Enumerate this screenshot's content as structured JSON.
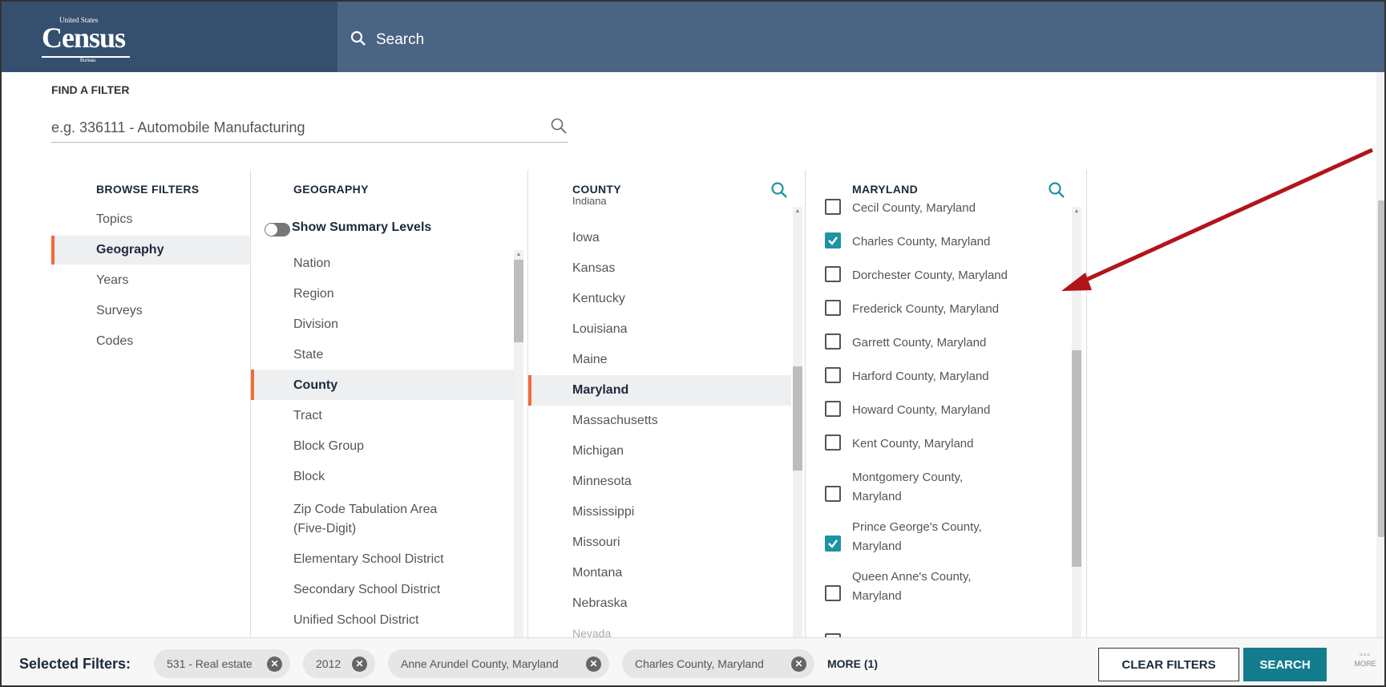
{
  "header": {
    "logo_small": "United States",
    "logo_big": "Census",
    "logo_bureau": "Bureau",
    "search_label": "Search"
  },
  "find_filter": {
    "label": "FIND A FILTER",
    "placeholder": "e.g. 336111 - Automobile Manufacturing",
    "value": ""
  },
  "browse": {
    "title": "BROWSE FILTERS",
    "items": [
      {
        "label": "Topics",
        "selected": false
      },
      {
        "label": "Geography",
        "selected": true
      },
      {
        "label": "Years",
        "selected": false
      },
      {
        "label": "Surveys",
        "selected": false
      },
      {
        "label": "Codes",
        "selected": false
      }
    ]
  },
  "geography": {
    "title": "GEOGRAPHY",
    "toggle_label": "Show Summary Levels",
    "toggle_on": false,
    "items": [
      {
        "label": "Nation",
        "selected": false
      },
      {
        "label": "Region",
        "selected": false
      },
      {
        "label": "Division",
        "selected": false
      },
      {
        "label": "State",
        "selected": false
      },
      {
        "label": "County",
        "selected": true
      },
      {
        "label": "Tract",
        "selected": false
      },
      {
        "label": "Block Group",
        "selected": false
      },
      {
        "label": "Block",
        "selected": false
      },
      {
        "label": "Zip Code Tabulation Area",
        "label2": "(Five-Digit)",
        "selected": false
      },
      {
        "label": "Elementary School District",
        "selected": false
      },
      {
        "label": "Secondary School District",
        "selected": false
      },
      {
        "label": "Unified School District",
        "selected": false
      }
    ]
  },
  "county": {
    "title": "COUNTY",
    "partial_top": "Indiana",
    "partial_bottom": "Nevada",
    "items": [
      {
        "label": "Iowa",
        "selected": false
      },
      {
        "label": "Kansas",
        "selected": false
      },
      {
        "label": "Kentucky",
        "selected": false
      },
      {
        "label": "Louisiana",
        "selected": false
      },
      {
        "label": "Maine",
        "selected": false
      },
      {
        "label": "Maryland",
        "selected": true
      },
      {
        "label": "Massachusetts",
        "selected": false
      },
      {
        "label": "Michigan",
        "selected": false
      },
      {
        "label": "Minnesota",
        "selected": false
      },
      {
        "label": "Mississippi",
        "selected": false
      },
      {
        "label": "Missouri",
        "selected": false
      },
      {
        "label": "Montana",
        "selected": false
      },
      {
        "label": "Nebraska",
        "selected": false
      }
    ]
  },
  "maryland": {
    "title": "MARYLAND",
    "items": [
      {
        "label": "Cecil County, Maryland",
        "checked": false
      },
      {
        "label": "Charles County, Maryland",
        "checked": true
      },
      {
        "label": "Dorchester County, Maryland",
        "checked": false
      },
      {
        "label": "Frederick County, Maryland",
        "checked": false
      },
      {
        "label": "Garrett County, Maryland",
        "checked": false
      },
      {
        "label": "Harford County, Maryland",
        "checked": false
      },
      {
        "label": "Howard County, Maryland",
        "checked": false
      },
      {
        "label": "Kent County, Maryland",
        "checked": false
      },
      {
        "label": "Montgomery County,",
        "label2": "Maryland",
        "checked": false
      },
      {
        "label": "Prince George's County,",
        "label2": "Maryland",
        "checked": true
      },
      {
        "label": "Queen Anne's County,",
        "label2": "Maryland",
        "checked": false
      }
    ]
  },
  "bottom": {
    "selected_label": "Selected Filters:",
    "chips": [
      {
        "label": "531 - Real estate"
      },
      {
        "label": "2012"
      },
      {
        "label": "Anne Arundel County, Maryland"
      },
      {
        "label": "Charles County, Maryland"
      }
    ],
    "more_link": "MORE (1)",
    "clear_label": "CLEAR FILTERS",
    "search_label": "SEARCH",
    "more_btn_label": "MORE"
  },
  "colors": {
    "header_bg": "#35506f",
    "accent_orange": "#f26b3a",
    "accent_teal": "#1d93a4",
    "annotation_red": "#b0151a"
  }
}
